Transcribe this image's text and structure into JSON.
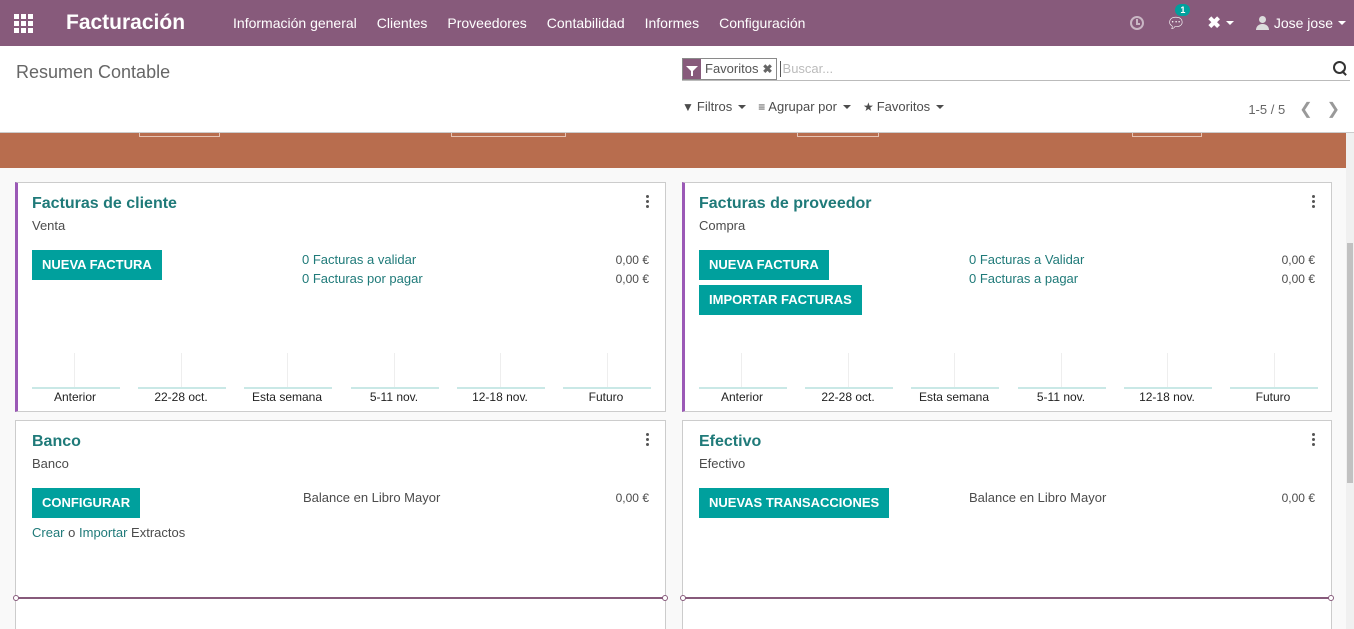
{
  "navbar": {
    "app_title": "Facturación",
    "menu": [
      "Información general",
      "Clientes",
      "Proveedores",
      "Contabilidad",
      "Informes",
      "Configuración"
    ],
    "chat_badge": "1",
    "user": "Jose jose"
  },
  "control_panel": {
    "title": "Resumen Contable",
    "facet": "Favoritos",
    "search_placeholder": "Buscar...",
    "filters_label": "Filtros",
    "groupby_label": "Agrupar por",
    "favorites_label": "Favoritos",
    "pager": "1-5 / 5"
  },
  "colors": {
    "navbar": "#875a7b",
    "accent_button": "#00a09d",
    "link": "#1f7a79",
    "banner": "#b86d4e",
    "card_accent": "#9b59b6"
  },
  "cards": {
    "customer_invoices": {
      "title": "Facturas de cliente",
      "subtitle": "Venta",
      "button": "NUEVA FACTURA",
      "stats": [
        {
          "label": "0 Facturas a validar",
          "value": "0,00 €"
        },
        {
          "label": "0 Facturas por pagar",
          "value": "0,00 €"
        }
      ],
      "chart_ticks": [
        "Anterior",
        "22-28 oct.",
        "Esta semana",
        "5-11 nov.",
        "12-18 nov.",
        "Futuro"
      ]
    },
    "vendor_bills": {
      "title": "Facturas de proveedor",
      "subtitle": "Compra",
      "button": "NUEVA FACTURA",
      "button2": "IMPORTAR FACTURAS",
      "stats": [
        {
          "label": "0 Facturas a Validar",
          "value": "0,00 €"
        },
        {
          "label": "0 Facturas a pagar",
          "value": "0,00 €"
        }
      ],
      "chart_ticks": [
        "Anterior",
        "22-28 oct.",
        "Esta semana",
        "5-11 nov.",
        "12-18 nov.",
        "Futuro"
      ]
    },
    "bank": {
      "title": "Banco",
      "subtitle": "Banco",
      "button": "CONFIGURAR",
      "balance_label": "Balance en Libro Mayor",
      "balance_value": "0,00 €",
      "link_create": "Crear",
      "link_or": "o",
      "link_import": "Importar",
      "link_suffix": "Extractos"
    },
    "cash": {
      "title": "Efectivo",
      "subtitle": "Efectivo",
      "button": "NUEVAS TRANSACCIONES",
      "balance_label": "Balance en Libro Mayor",
      "balance_value": "0,00 €"
    }
  }
}
